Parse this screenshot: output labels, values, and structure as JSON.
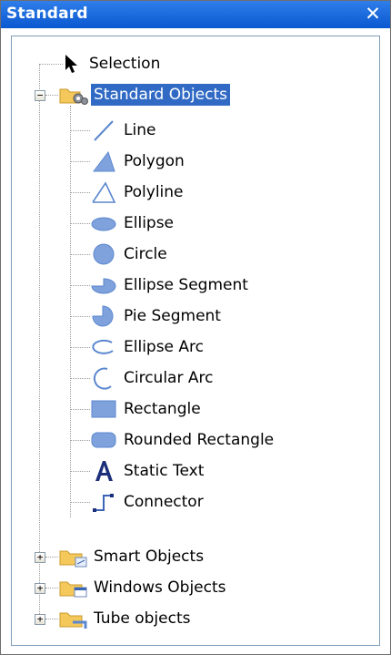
{
  "window": {
    "title": "Standard"
  },
  "tree": {
    "root_selection": {
      "label": "Selection",
      "icon": "arrow-cursor-icon"
    },
    "groups": [
      {
        "label": "Standard Objects",
        "expanded": true,
        "selected": true,
        "expander": "−",
        "icon": "folder-gears-icon",
        "items": [
          {
            "label": "Line",
            "icon": "line-icon"
          },
          {
            "label": "Polygon",
            "icon": "polygon-icon"
          },
          {
            "label": "Polyline",
            "icon": "polyline-icon"
          },
          {
            "label": "Ellipse",
            "icon": "ellipse-icon"
          },
          {
            "label": "Circle",
            "icon": "circle-icon"
          },
          {
            "label": "Ellipse Segment",
            "icon": "ellipse-segment-icon"
          },
          {
            "label": "Pie Segment",
            "icon": "pie-segment-icon"
          },
          {
            "label": "Ellipse Arc",
            "icon": "ellipse-arc-icon"
          },
          {
            "label": "Circular Arc",
            "icon": "circular-arc-icon"
          },
          {
            "label": "Rectangle",
            "icon": "rectangle-icon"
          },
          {
            "label": "Rounded Rectangle",
            "icon": "rounded-rectangle-icon"
          },
          {
            "label": "Static Text",
            "icon": "static-text-icon"
          },
          {
            "label": "Connector",
            "icon": "connector-icon"
          }
        ]
      },
      {
        "label": "Smart Objects",
        "expanded": false,
        "expander": "+",
        "icon": "folder-smart-icon"
      },
      {
        "label": "Windows Objects",
        "expanded": false,
        "expander": "+",
        "icon": "folder-windows-icon"
      },
      {
        "label": "Tube objects",
        "expanded": false,
        "expander": "+",
        "icon": "folder-tube-icon"
      }
    ]
  },
  "colors": {
    "title_bar": "#0a58d0",
    "selection_highlight": "#316ac5",
    "shape_fill": "#7fa2dc"
  }
}
